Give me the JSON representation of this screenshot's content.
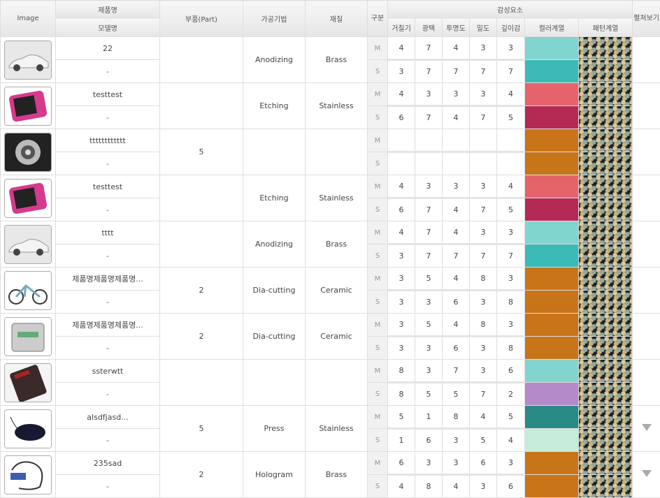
{
  "header": {
    "image": "Image",
    "product_name": "제품명",
    "model_name": "모델명",
    "part": "부품(Part)",
    "process": "가공기법",
    "material": "재질",
    "gubun": "구분",
    "emotion": "감성요소",
    "feature": "펼쳐보기",
    "sub": [
      "거칠기",
      "광택",
      "투명도",
      "밀도",
      "깊이감",
      "컬러계열",
      "패턴계열"
    ]
  },
  "rows": [
    {
      "thumb": "car-thumbnail",
      "name": "22",
      "model": "-",
      "part": "",
      "process": "Anodizing",
      "material": "Brass",
      "m": {
        "label": "M",
        "v": [
          "4",
          "7",
          "4",
          "3",
          "3"
        ],
        "color": "#82d4cf"
      },
      "s": {
        "label": "S",
        "v": [
          "3",
          "7",
          "7",
          "7",
          "7"
        ],
        "color": "#3bbab8"
      },
      "feature": false
    },
    {
      "thumb": "media-player-thumbnail",
      "name": "testtest",
      "model": "-",
      "part": "",
      "process": "Etching",
      "material": "Stainless",
      "m": {
        "label": "M",
        "v": [
          "4",
          "3",
          "3",
          "3",
          "4"
        ],
        "color": "#e5646c"
      },
      "s": {
        "label": "S",
        "v": [
          "6",
          "7",
          "4",
          "7",
          "5"
        ],
        "color": "#b42a55"
      },
      "feature": false
    },
    {
      "thumb": "camera-dial-thumbnail",
      "name": "tttttttttttt",
      "model": "-",
      "part": "5",
      "process": "",
      "material": "",
      "m": {
        "label": "M",
        "v": [
          "",
          "",
          "",
          "",
          ""
        ],
        "color": "#c87418"
      },
      "s": {
        "label": "S",
        "v": [
          "",
          "",
          "",
          "",
          ""
        ],
        "color": "#c87418"
      },
      "feature": false
    },
    {
      "thumb": "media-player-thumbnail",
      "name": "testtest",
      "model": "-",
      "part": "",
      "process": "Etching",
      "material": "Stainless",
      "m": {
        "label": "M",
        "v": [
          "4",
          "3",
          "3",
          "3",
          "4"
        ],
        "color": "#e5646c"
      },
      "s": {
        "label": "S",
        "v": [
          "6",
          "7",
          "4",
          "7",
          "5"
        ],
        "color": "#b42a55"
      },
      "feature": false
    },
    {
      "thumb": "car-thumbnail",
      "name": "tttt",
      "model": "-",
      "part": "",
      "process": "Anodizing",
      "material": "Brass",
      "m": {
        "label": "M",
        "v": [
          "4",
          "7",
          "4",
          "3",
          "3"
        ],
        "color": "#82d4cf"
      },
      "s": {
        "label": "S",
        "v": [
          "3",
          "7",
          "7",
          "7",
          "7"
        ],
        "color": "#3bbab8"
      },
      "feature": false
    },
    {
      "thumb": "bicycle-thumbnail",
      "name": "제품명제품명제품명...",
      "model": "-",
      "part": "2",
      "process": "Dia-cutting",
      "material": "Ceramic",
      "m": {
        "label": "M",
        "v": [
          "3",
          "5",
          "4",
          "8",
          "3"
        ],
        "color": "#c87418"
      },
      "s": {
        "label": "S",
        "v": [
          "3",
          "3",
          "6",
          "3",
          "8"
        ],
        "color": "#c87418"
      },
      "feature": false
    },
    {
      "thumb": "machine-thumbnail",
      "name": "제품명제품명제품명...",
      "model": "-",
      "part": "2",
      "process": "Dia-cutting",
      "material": "Ceramic",
      "m": {
        "label": "M",
        "v": [
          "3",
          "5",
          "4",
          "8",
          "3"
        ],
        "color": "#c87418"
      },
      "s": {
        "label": "S",
        "v": [
          "3",
          "3",
          "6",
          "3",
          "8"
        ],
        "color": "#c87418"
      },
      "feature": false
    },
    {
      "thumb": "calculator-thumbnail",
      "name": "ssterwtt",
      "model": "-",
      "part": "",
      "process": "",
      "material": "",
      "m": {
        "label": "M",
        "v": [
          "8",
          "3",
          "7",
          "3",
          "6"
        ],
        "color": "#82d4cf"
      },
      "s": {
        "label": "S",
        "v": [
          "8",
          "5",
          "5",
          "7",
          "2"
        ],
        "color": "#b48ac8"
      },
      "feature": false
    },
    {
      "thumb": "mouse-thumbnail",
      "name": "alsdfjasd...",
      "model": "-",
      "part": "5",
      "process": "Press",
      "material": "Stainless",
      "m": {
        "label": "M",
        "v": [
          "5",
          "1",
          "8",
          "4",
          "5"
        ],
        "color": "#2a8a84"
      },
      "s": {
        "label": "S",
        "v": [
          "1",
          "6",
          "3",
          "5",
          "4"
        ],
        "color": "#c4ecd8"
      },
      "feature": true
    },
    {
      "thumb": "usb-device-thumbnail",
      "name": "235sad",
      "model": "-",
      "part": "2",
      "process": "Hologram",
      "material": "Brass",
      "m": {
        "label": "M",
        "v": [
          "6",
          "3",
          "3",
          "6",
          "3"
        ],
        "color": "#c87418"
      },
      "s": {
        "label": "S",
        "v": [
          "4",
          "8",
          "4",
          "3",
          "6"
        ],
        "color": "#c87418"
      },
      "feature": true
    }
  ]
}
